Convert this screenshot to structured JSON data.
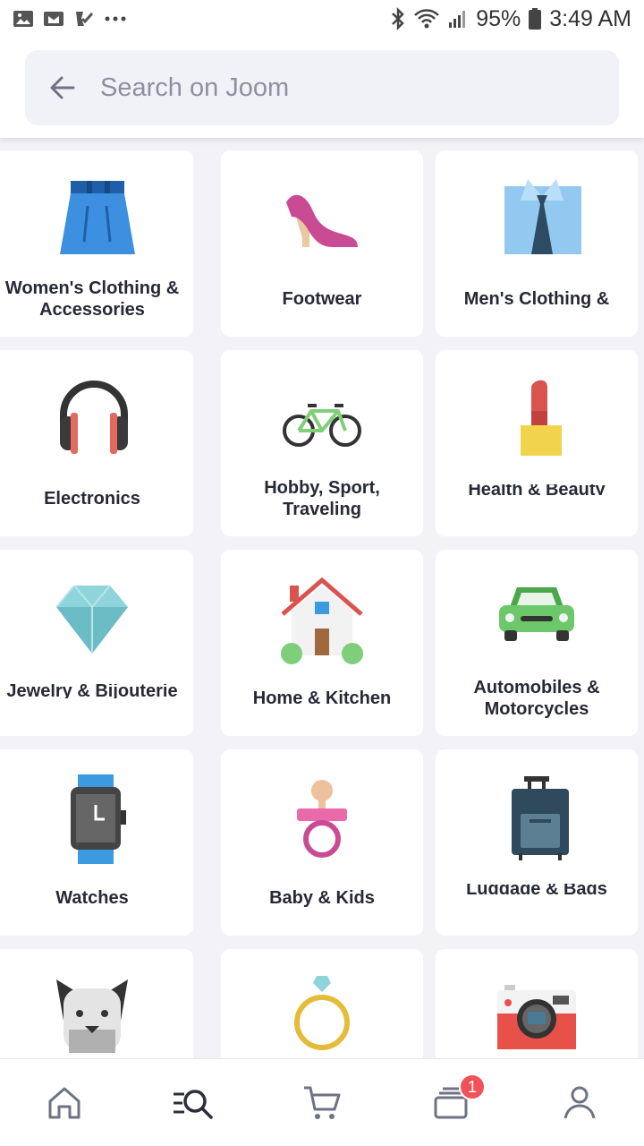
{
  "status_bar": {
    "battery": "95%",
    "time": "3:49 AM"
  },
  "search": {
    "placeholder": "Search on Joom"
  },
  "categories": [
    {
      "label": "Women's Clothing & Accessories",
      "icon": "skirt-icon"
    },
    {
      "label": "Footwear",
      "icon": "high-heel-icon"
    },
    {
      "label": "Men's Clothing &",
      "icon": "shirt-tie-icon"
    },
    {
      "label": "Electronics",
      "icon": "headphones-icon"
    },
    {
      "label": "Hobby, Sport, Traveling",
      "icon": "bicycle-icon"
    },
    {
      "label": "Health & Beauty",
      "icon": "lipstick-icon"
    },
    {
      "label": "Jewelry & Bijouterie",
      "icon": "diamond-icon"
    },
    {
      "label": "Home & Kitchen",
      "icon": "house-icon"
    },
    {
      "label": "Automobiles & Motorcycles",
      "icon": "car-icon"
    },
    {
      "label": "Watches",
      "icon": "watch-icon"
    },
    {
      "label": "Baby & Kids",
      "icon": "pacifier-icon"
    },
    {
      "label": "Luggage & Bags",
      "icon": "suitcase-icon"
    },
    {
      "label": "",
      "icon": "dog-icon"
    },
    {
      "label": "",
      "icon": "ring-icon"
    },
    {
      "label": "",
      "icon": "camera-icon"
    }
  ],
  "bottom_nav": {
    "items": [
      {
        "icon": "home-icon"
      },
      {
        "icon": "search-list-icon"
      },
      {
        "icon": "cart-icon"
      },
      {
        "icon": "orders-icon",
        "badge": "1"
      },
      {
        "icon": "profile-icon"
      }
    ]
  },
  "colors": {
    "background": "#f3f3f7",
    "card": "#ffffff",
    "badge": "#f0525a",
    "text": "#262a36",
    "placeholder": "#8d90a0"
  }
}
